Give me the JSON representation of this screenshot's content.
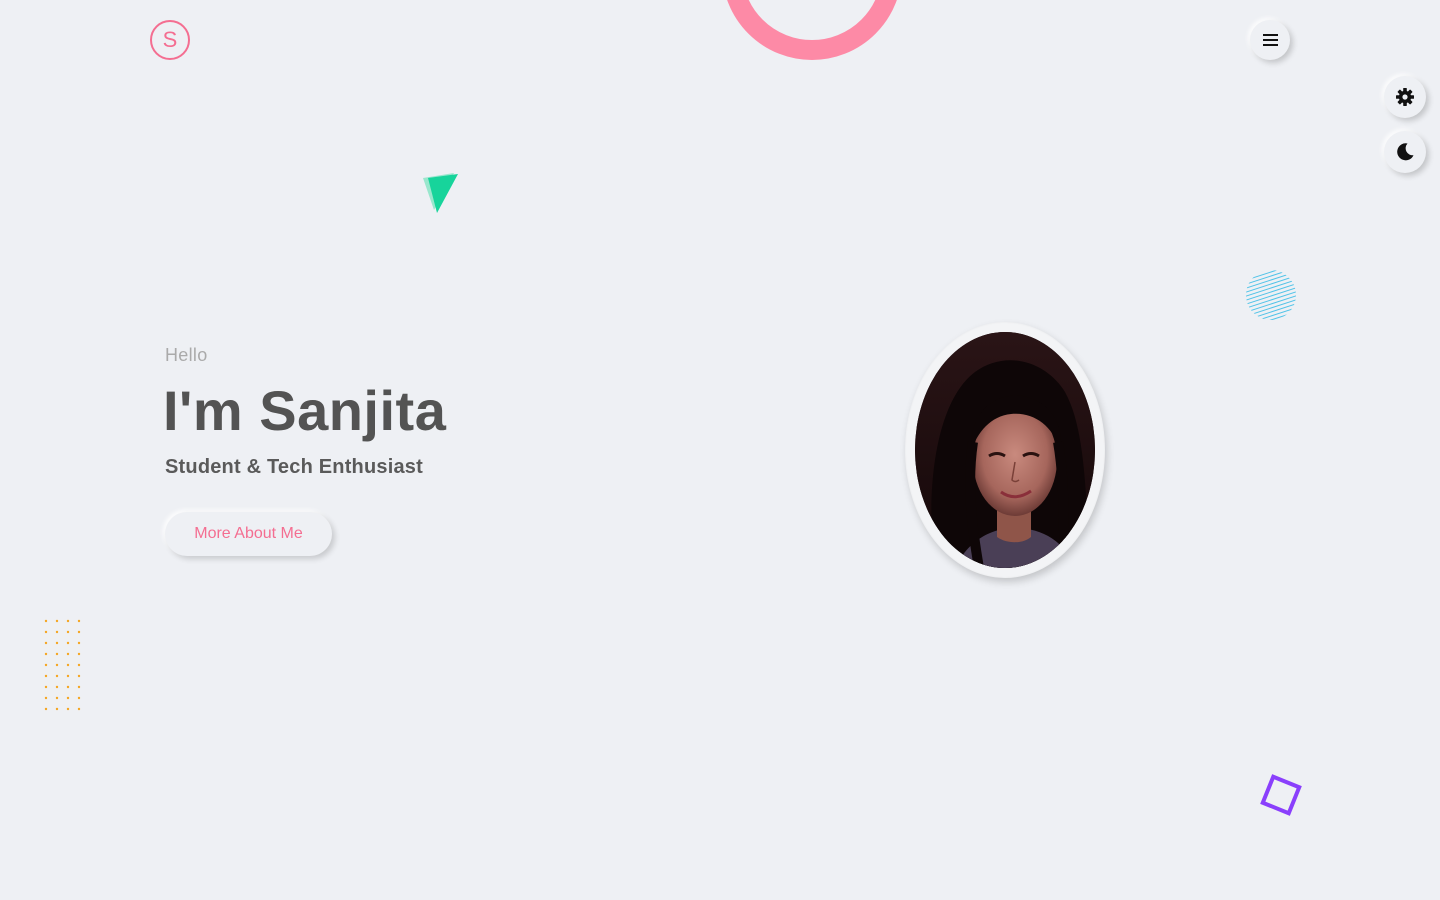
{
  "brand": {
    "logo_letter": "S",
    "accent_color": "#f46e91"
  },
  "header": {
    "menu_icon": "hamburger-icon"
  },
  "side_controls": {
    "settings_icon": "gear-icon",
    "theme_icon": "moon-icon"
  },
  "hero": {
    "greeting": "Hello",
    "headline": "I'm Sanjita",
    "subtitle": "Student & Tech Enthusiast",
    "cta_label": "More About Me"
  },
  "decorations": {
    "ring_color": "#fd8aa6",
    "triangle_color": "#2ad4a0",
    "striped_circle_color": "#4fc3e8",
    "dot_grid_color": "#f5a623",
    "square_color": "#8a3ffc"
  }
}
